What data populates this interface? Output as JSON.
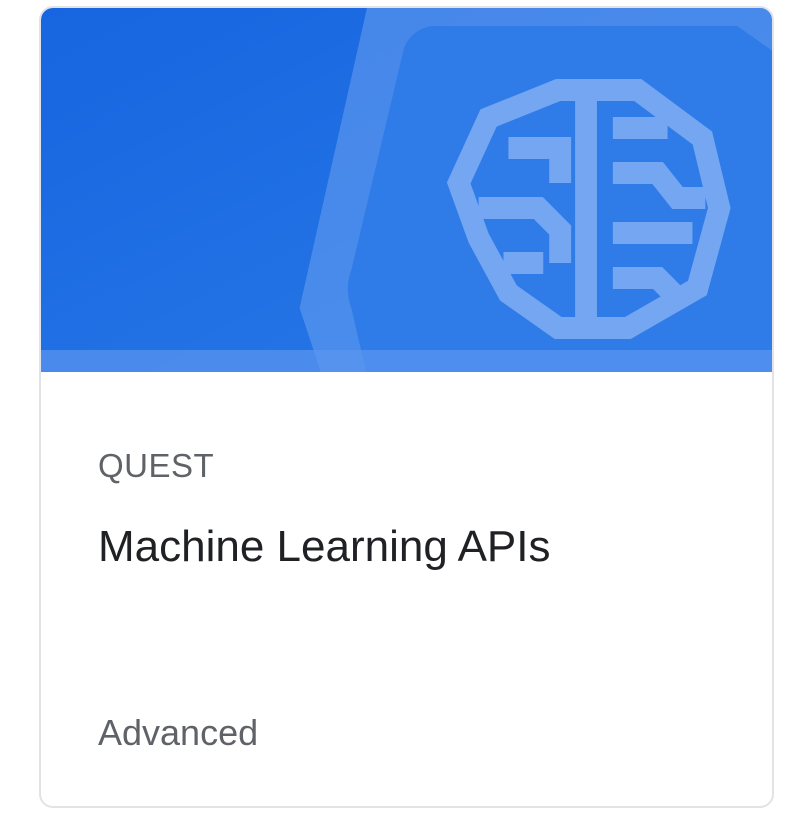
{
  "card": {
    "kind_label": "QUEST",
    "title": "Machine Learning APIs",
    "level": "Advanced",
    "icon": "brain-icon"
  },
  "colors": {
    "banner_blue": "#1f6fe5",
    "hexagon_blue": "#3a86ec",
    "brain_light": "#74a6f1",
    "card_border": "#e2e3e6",
    "kind_text": "#5f6368",
    "title_text": "#202124"
  }
}
